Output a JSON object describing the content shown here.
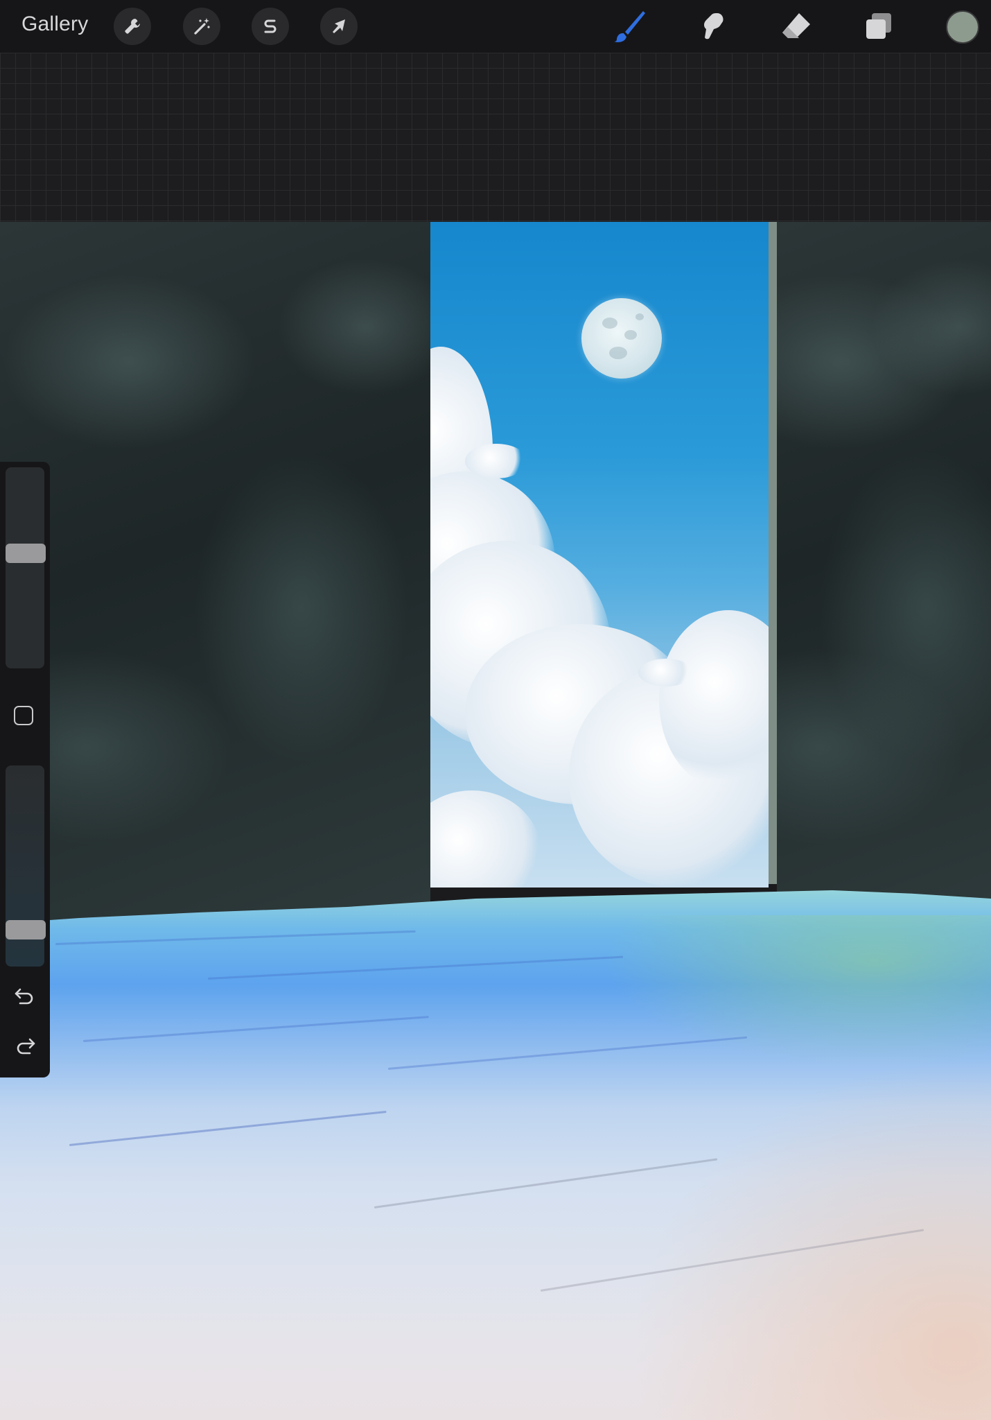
{
  "app": {
    "gallery_label": "Gallery"
  },
  "toolbar": {
    "left_tools": [
      {
        "name": "actions",
        "icon": "wrench-icon"
      },
      {
        "name": "adjustments",
        "icon": "magic-wand-icon"
      },
      {
        "name": "selection",
        "icon": "selection-s-icon"
      },
      {
        "name": "transform",
        "icon": "arrow-cursor-icon"
      }
    ],
    "right_tools": [
      {
        "name": "brush",
        "icon": "brush-icon",
        "active": true
      },
      {
        "name": "smudge",
        "icon": "smudge-icon",
        "active": false
      },
      {
        "name": "eraser",
        "icon": "eraser-icon",
        "active": false
      },
      {
        "name": "layers",
        "icon": "layers-icon",
        "active": false
      }
    ],
    "current_color": "#8d9b8e",
    "active_tool_color": "#2f6ee0"
  },
  "sidebar": {
    "brush_size": 0.58,
    "opacity": 0.15,
    "controls": [
      "modifier-button",
      "undo-icon",
      "redo-icon"
    ]
  },
  "colors": {
    "toolbar_bg": "#161618",
    "workspace_bg": "#1d1d1f",
    "icon_color": "#d6d6d8"
  }
}
